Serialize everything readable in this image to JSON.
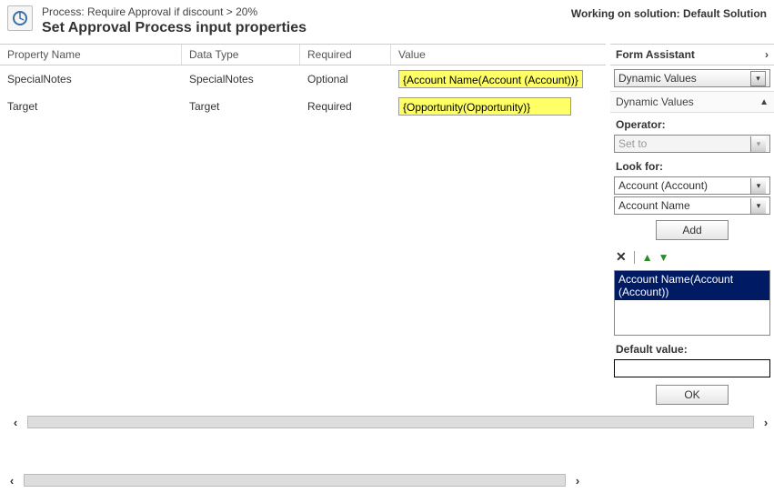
{
  "header": {
    "process_prefix": "Process: ",
    "process_name": "Require Approval if discount > 20%",
    "title": "Set Approval Process input properties",
    "solution_prefix": "Working on solution: ",
    "solution_name": "Default Solution"
  },
  "grid": {
    "columns": {
      "name": "Property Name",
      "type": "Data Type",
      "required": "Required",
      "value": "Value"
    },
    "rows": [
      {
        "name": "SpecialNotes",
        "type": "SpecialNotes",
        "required": "Optional",
        "value": "{Account Name(Account (Account))}"
      },
      {
        "name": "Target",
        "type": "Target",
        "required": "Required",
        "value": "{Opportunity(Opportunity)}"
      }
    ]
  },
  "assistant": {
    "title": "Form Assistant",
    "dropdown": "Dynamic Values",
    "section": "Dynamic Values",
    "operator_label": "Operator:",
    "operator_value": "Set to",
    "lookfor_label": "Look for:",
    "lookfor_entity": "Account (Account)",
    "lookfor_attr": "Account Name",
    "add_label": "Add",
    "selected_item": "Account Name(Account (Account))",
    "default_label": "Default value:",
    "ok_label": "OK"
  }
}
